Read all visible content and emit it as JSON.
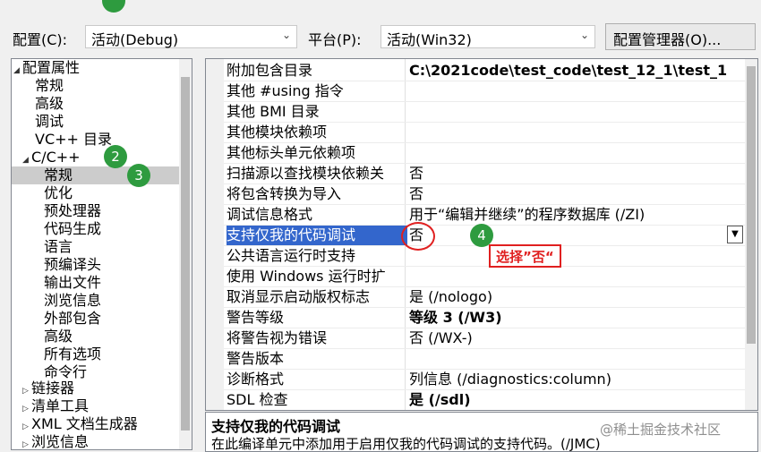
{
  "annotations": {
    "badges": [
      "2",
      "3",
      "4"
    ],
    "callout": "选择”否“"
  },
  "toolbar": {
    "config_label": "配置(C):",
    "config_value": "活动(Debug)",
    "platform_label": "平台(P):",
    "platform_value": "活动(Win32)",
    "manager_button": "配置管理器(O)..."
  },
  "tree": {
    "items": [
      {
        "label": "配置属性",
        "twisty": "◢"
      },
      {
        "label": "常规"
      },
      {
        "label": "高级"
      },
      {
        "label": "调试"
      },
      {
        "label": "VC++ 目录"
      },
      {
        "label": "C/C++",
        "twisty": "◢"
      },
      {
        "label": "常规"
      },
      {
        "label": "优化"
      },
      {
        "label": "预处理器"
      },
      {
        "label": "代码生成"
      },
      {
        "label": "语言"
      },
      {
        "label": "预编译头"
      },
      {
        "label": "输出文件"
      },
      {
        "label": "浏览信息"
      },
      {
        "label": "外部包含"
      },
      {
        "label": "高级"
      },
      {
        "label": "所有选项"
      },
      {
        "label": "命令行"
      },
      {
        "label": "链接器",
        "twisty": "▷"
      },
      {
        "label": "清单工具",
        "twisty": "▷"
      },
      {
        "label": "XML 文档生成器",
        "twisty": "▷"
      },
      {
        "label": "浏览信息",
        "twisty": "▷"
      }
    ]
  },
  "grid": {
    "rows": [
      {
        "name": "附加包含目录",
        "value": "C:\\2021code\\test_code\\test_12_1\\test_1",
        "bold": true
      },
      {
        "name": "其他 #using 指令",
        "value": ""
      },
      {
        "name": "其他 BMI 目录",
        "value": ""
      },
      {
        "name": "其他模块依赖项",
        "value": ""
      },
      {
        "name": "其他标头单元依赖项",
        "value": ""
      },
      {
        "name": "扫描源以查找模块依赖关",
        "value": "否"
      },
      {
        "name": "将包含转换为导入",
        "value": "否"
      },
      {
        "name": "调试信息格式",
        "value": "用于“编辑并继续”的程序数据库 (/ZI)"
      },
      {
        "name": "支持仅我的代码调试",
        "value": "否"
      },
      {
        "name": "公共语言运行时支持",
        "value": ""
      },
      {
        "name": "使用 Windows 运行时扩",
        "value": ""
      },
      {
        "name": "取消显示启动版权标志",
        "value": "是 (/nologo)"
      },
      {
        "name": "警告等级",
        "value": "等级 3 (/W3)",
        "bold": true
      },
      {
        "name": "将警告视为错误",
        "value": "否 (/WX-)"
      },
      {
        "name": "警告版本",
        "value": ""
      },
      {
        "name": "诊断格式",
        "value": "列信息 (/diagnostics:column)"
      },
      {
        "name": "SDL 检查",
        "value": "是 (/sdl)",
        "bold": true
      }
    ],
    "selected_row": "支持仅我的代码调试",
    "dropdown_icon": "dropdown-arrow-icon"
  },
  "description": {
    "title": "支持仅我的代码调试",
    "text": "在此编译单元中添加用于启用仅我的代码调试的支持代码。(/JMC)"
  },
  "watermark": "@稀土掘金技术社区",
  "colors": {
    "selection_blue": "#3366cc",
    "badge_green": "#2e9b3f",
    "annotation_red": "#e02020"
  }
}
